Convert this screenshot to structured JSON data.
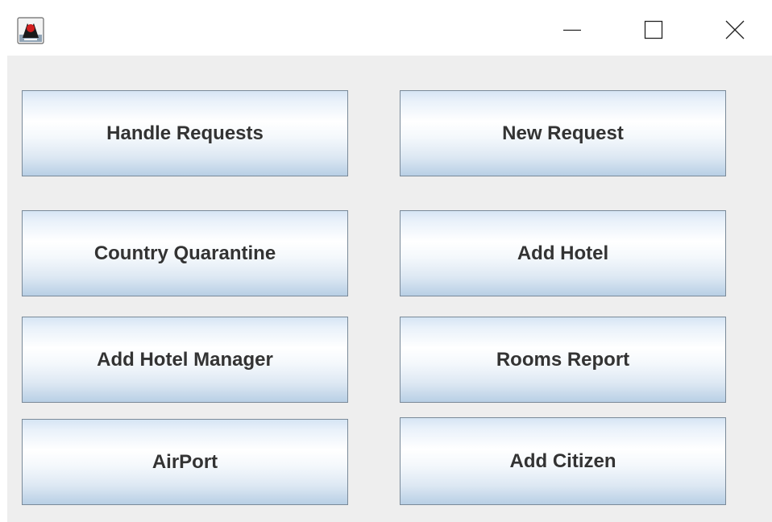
{
  "window": {
    "app_icon": "java-duke-icon",
    "controls": {
      "minimize_icon": "minimize-icon",
      "maximize_icon": "maximize-icon",
      "close_icon": "close-icon"
    }
  },
  "buttons": {
    "handle_requests": "Handle Requests",
    "new_request": "New Request",
    "country_quarantine": "Country Quarantine",
    "add_hotel": "Add Hotel",
    "add_hotel_manager": "Add Hotel Manager",
    "rooms_report": "Rooms Report",
    "airport": "AirPort",
    "add_citizen": "Add Citizen"
  },
  "colors": {
    "content_background": "#eeeeee",
    "button_border": "#7a8a99",
    "button_text": "#333333"
  }
}
